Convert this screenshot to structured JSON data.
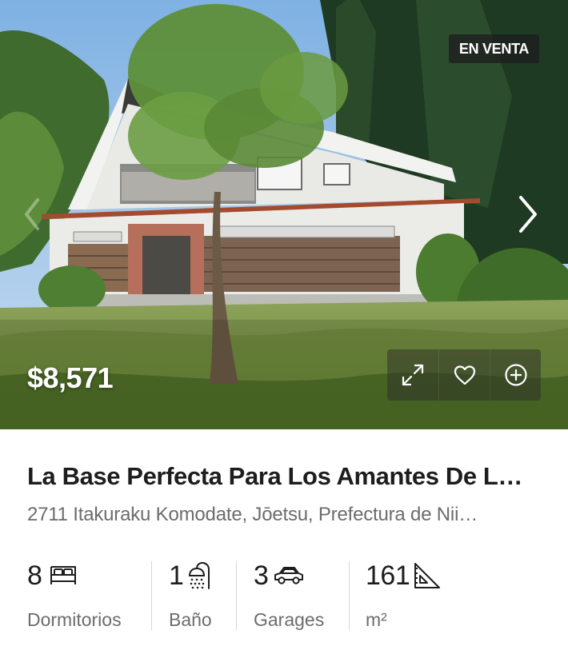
{
  "listing": {
    "status_badge": "EN VENTA",
    "price": "$8,571",
    "title": "La Base Perfecta Para Los Amantes De L…",
    "address": "2711 Itakuraku Komodate, Jōetsu, Prefectura de Nii…"
  },
  "features": [
    {
      "value": "8",
      "label": "Dormitorios",
      "icon": "bed-icon"
    },
    {
      "value": "1",
      "label": "Baño",
      "icon": "shower-icon"
    },
    {
      "value": "3",
      "label": "Garages",
      "icon": "car-icon"
    },
    {
      "value": "161",
      "label": "m²",
      "icon": "set-square-icon"
    }
  ],
  "photo_actions": [
    {
      "icon": "expand-icon"
    },
    {
      "icon": "heart-icon"
    },
    {
      "icon": "plus-circle-icon"
    }
  ],
  "navigation": {
    "next_icon": "chevron-right-icon",
    "prev_icon": "chevron-left-icon"
  },
  "colors": {
    "badge_bg": "#1e1e1e",
    "title": "#1d1d1d",
    "muted": "#6c6c6c"
  }
}
